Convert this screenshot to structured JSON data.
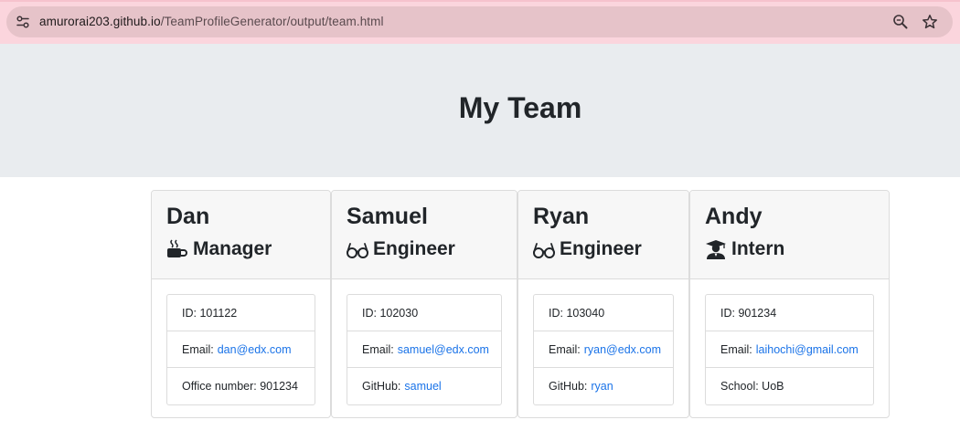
{
  "browser": {
    "url_host": "amurorai203.github.io",
    "url_path": "/TeamProfileGenerator/output/team.html"
  },
  "header": {
    "title": "My Team"
  },
  "team": [
    {
      "name": "Dan",
      "role": "Manager",
      "role_icon": "coffee-icon",
      "id_text": "ID: 101122",
      "email_label": "Email:",
      "email": "dan@edx.com",
      "extra_label": "Office number: 901234",
      "extra_link": ""
    },
    {
      "name": "Samuel",
      "role": "Engineer",
      "role_icon": "glasses-icon",
      "id_text": "ID: 102030",
      "email_label": "Email:",
      "email": "samuel@edx.com",
      "extra_label": "GitHub:",
      "extra_link": "samuel"
    },
    {
      "name": "Ryan",
      "role": "Engineer",
      "role_icon": "glasses-icon",
      "id_text": "ID: 103040",
      "email_label": "Email:",
      "email": "ryan@edx.com",
      "extra_label": "GitHub:",
      "extra_link": "ryan"
    },
    {
      "name": "Andy",
      "role": "Intern",
      "role_icon": "graduate-icon",
      "id_text": "ID: 901234",
      "email_label": "Email:",
      "email": "laihochi@gmail.com",
      "extra_label": "School: UoB",
      "extra_link": ""
    }
  ],
  "colors": {
    "link": "#1a73e8",
    "jumbotron": "#e9ecef",
    "browser_bar": "#fbd5dd"
  }
}
